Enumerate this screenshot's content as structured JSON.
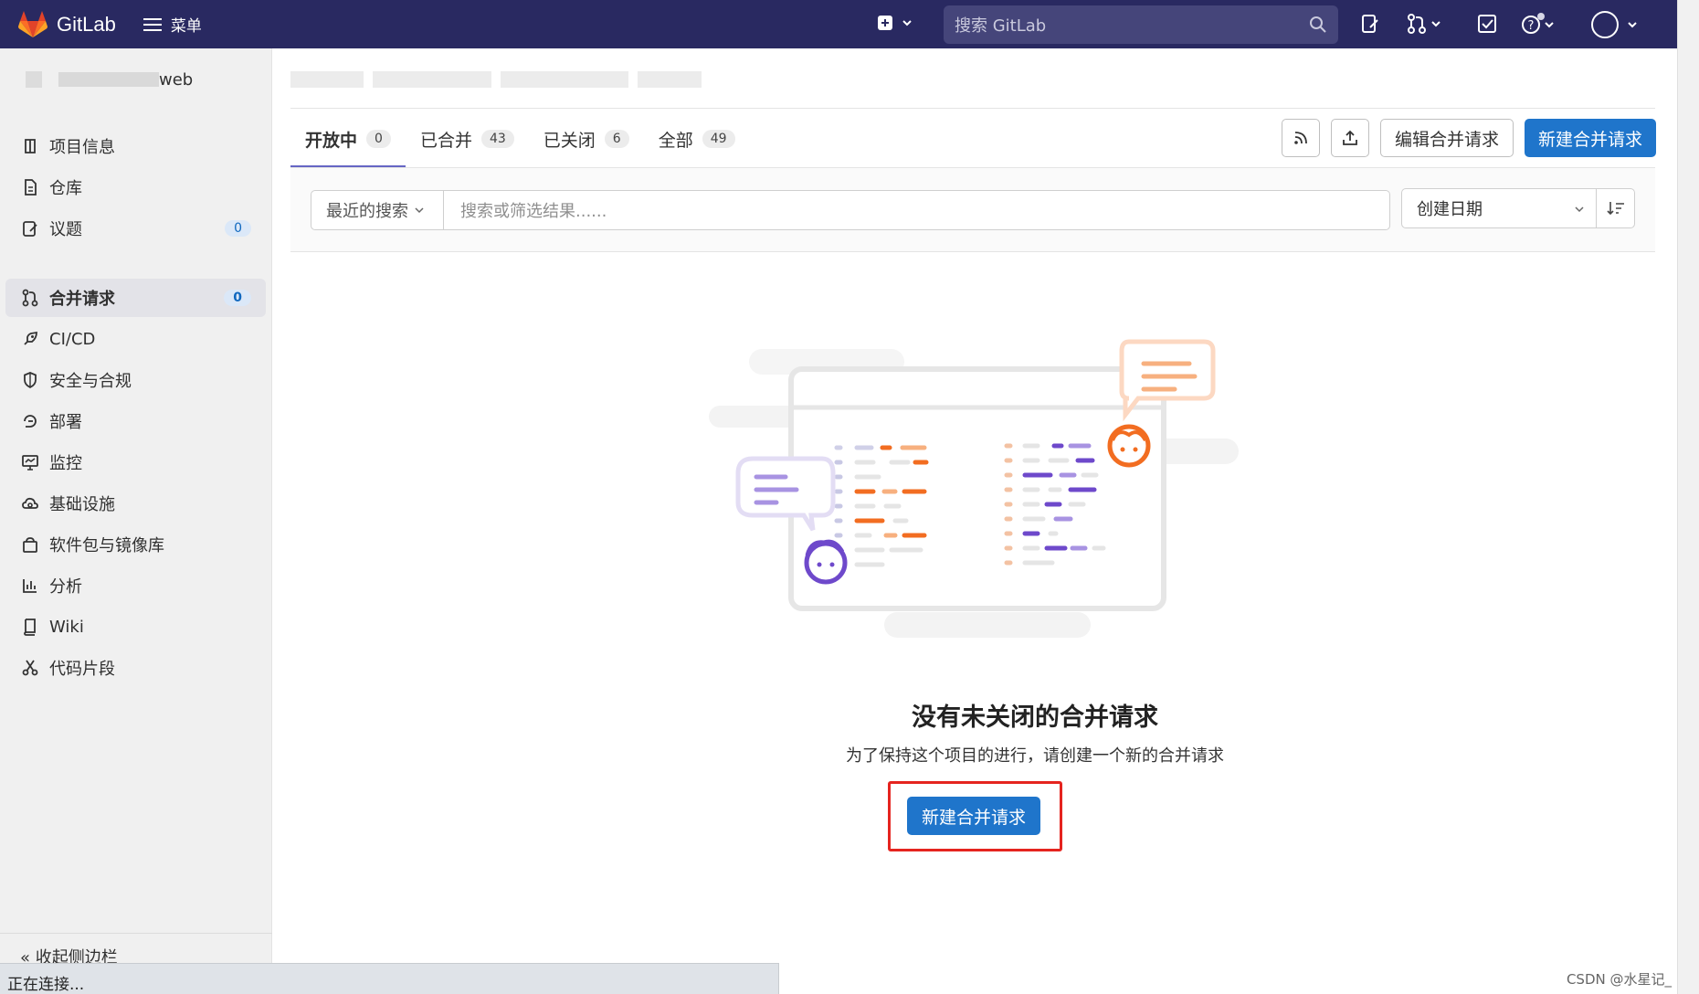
{
  "topbar": {
    "logo_text": "GitLab",
    "menu_label": "菜单",
    "search_placeholder": "搜索 GitLab",
    "brand_color": "#292961",
    "logo_colors": [
      "#e24329",
      "#fc6d26",
      "#fca326"
    ]
  },
  "sidebar": {
    "project_name_suffix": "web",
    "items": [
      {
        "label": "项目信息",
        "icon": "project-info-icon"
      },
      {
        "label": "仓库",
        "icon": "document-icon"
      },
      {
        "label": "议题",
        "icon": "issues-icon",
        "count": "0"
      },
      {
        "label": "合并请求",
        "icon": "merge-request-icon",
        "count": "0",
        "active": true
      },
      {
        "label": "CI/CD",
        "icon": "rocket-icon"
      },
      {
        "label": "安全与合规",
        "icon": "shield-icon"
      },
      {
        "label": "部署",
        "icon": "deploy-icon"
      },
      {
        "label": "监控",
        "icon": "monitor-icon"
      },
      {
        "label": "基础设施",
        "icon": "cloud-gear-icon"
      },
      {
        "label": "软件包与镜像库",
        "icon": "package-icon"
      },
      {
        "label": "分析",
        "icon": "chart-icon"
      },
      {
        "label": "Wiki",
        "icon": "book-icon"
      },
      {
        "label": "代码片段",
        "icon": "scissors-icon"
      }
    ],
    "collapse_label": "收起侧边栏"
  },
  "tabs": [
    {
      "label": "开放中",
      "count": "0",
      "active": true
    },
    {
      "label": "已合并",
      "count": "43"
    },
    {
      "label": "已关闭",
      "count": "6"
    },
    {
      "label": "全部",
      "count": "49"
    }
  ],
  "actions": {
    "edit_label": "编辑合并请求",
    "new_label": "新建合并请求"
  },
  "filter": {
    "recent_label": "最近的搜索",
    "search_placeholder": "搜索或筛选结果......",
    "sort_label": "创建日期"
  },
  "empty_state": {
    "title": "没有未关闭的合并请求",
    "description": "为了保持这个项目的进行，请创建一个新的合并请求",
    "button_label": "新建合并请求"
  },
  "status_bar": {
    "text": "正在连接..."
  },
  "watermark": "CSDN @水星记_"
}
